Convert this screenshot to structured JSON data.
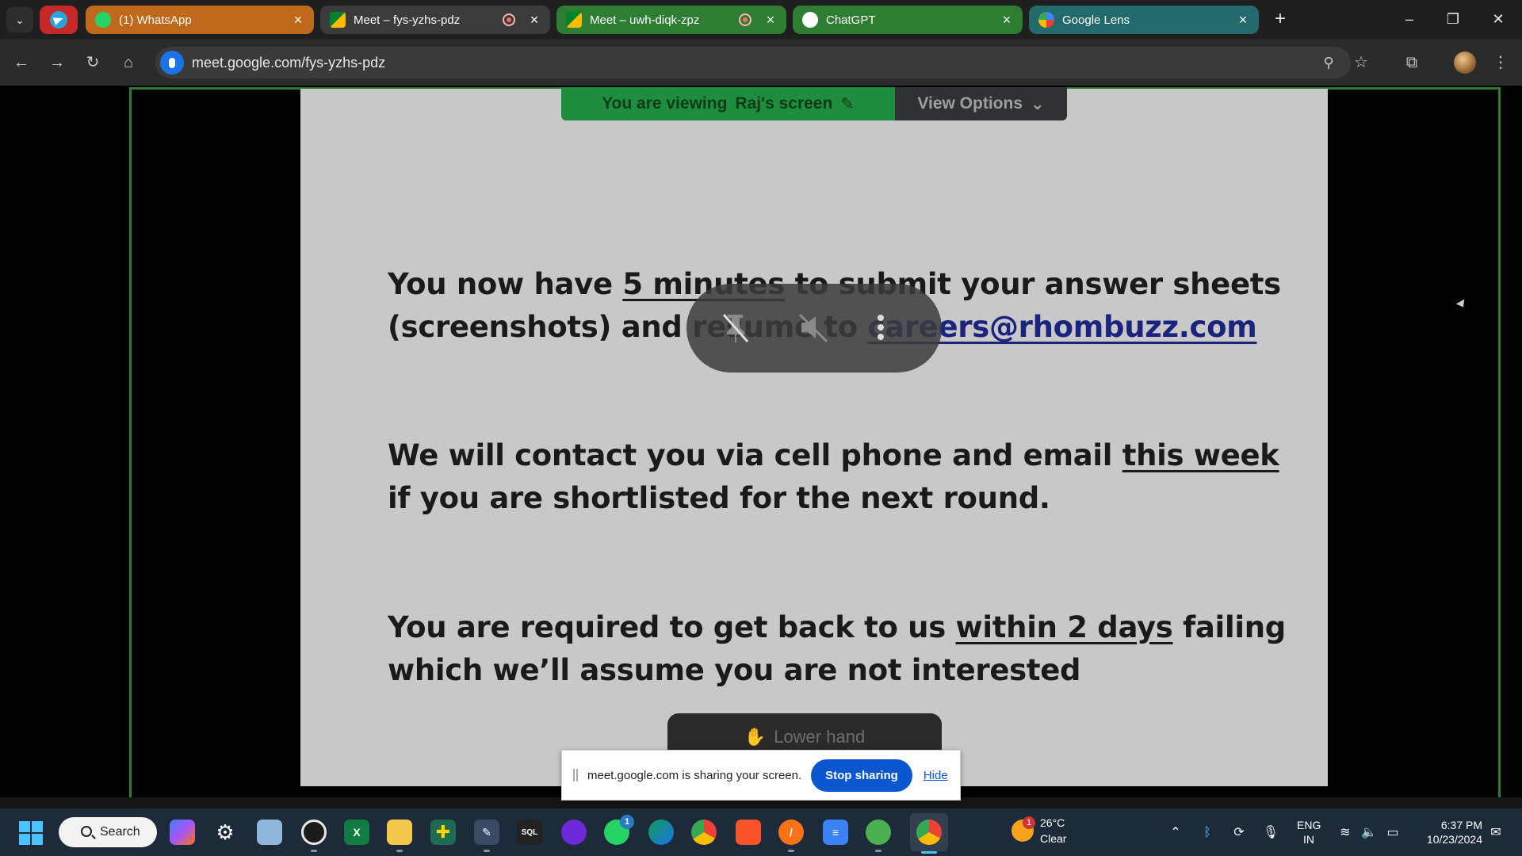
{
  "browser": {
    "tabs": [
      {
        "title": "(1) WhatsApp",
        "color": "#c0681b"
      },
      {
        "title": "Meet – fys-yzhs-pdz",
        "color": "#3b3b3b"
      },
      {
        "title": "Meet – uwh-diqk-zpz",
        "color": "#2e7d32"
      },
      {
        "title": "ChatGPT",
        "color": "#2e7d32"
      },
      {
        "title": "Google Lens",
        "color": "#24696b"
      }
    ],
    "url": "meet.google.com/fys-yzhs-pdz"
  },
  "meet": {
    "viewing_prefix": "You are viewing",
    "viewing_name": "Raj's screen",
    "view_options": "View Options",
    "lower_hand": "Lower hand",
    "slide": {
      "p1_a": "You now have ",
      "p1_u": "5 minutes",
      "p1_b": " to submit your answer sheets (screenshots) and resume to ",
      "p1_link": "careers@rhombuzz.com",
      "p2_a": "We will contact you via cell phone and email ",
      "p2_u": "this week",
      "p2_b": " if you are shortlisted for the next round.",
      "p3_a": "You are required to get back to us ",
      "p3_u": "within 2 days",
      "p3_b": " failing which we’ll assume you are not interested"
    }
  },
  "share_banner": {
    "message": "meet.google.com is sharing your screen.",
    "stop": "Stop sharing",
    "hide": "Hide"
  },
  "taskbar": {
    "search": "Search",
    "weather_temp": "26°C",
    "weather_cond": "Clear",
    "weather_badge": "1",
    "whatsapp_badge": "1",
    "lang_top": "ENG",
    "lang_bottom": "IN",
    "time": "6:37 PM",
    "date": "10/23/2024"
  }
}
